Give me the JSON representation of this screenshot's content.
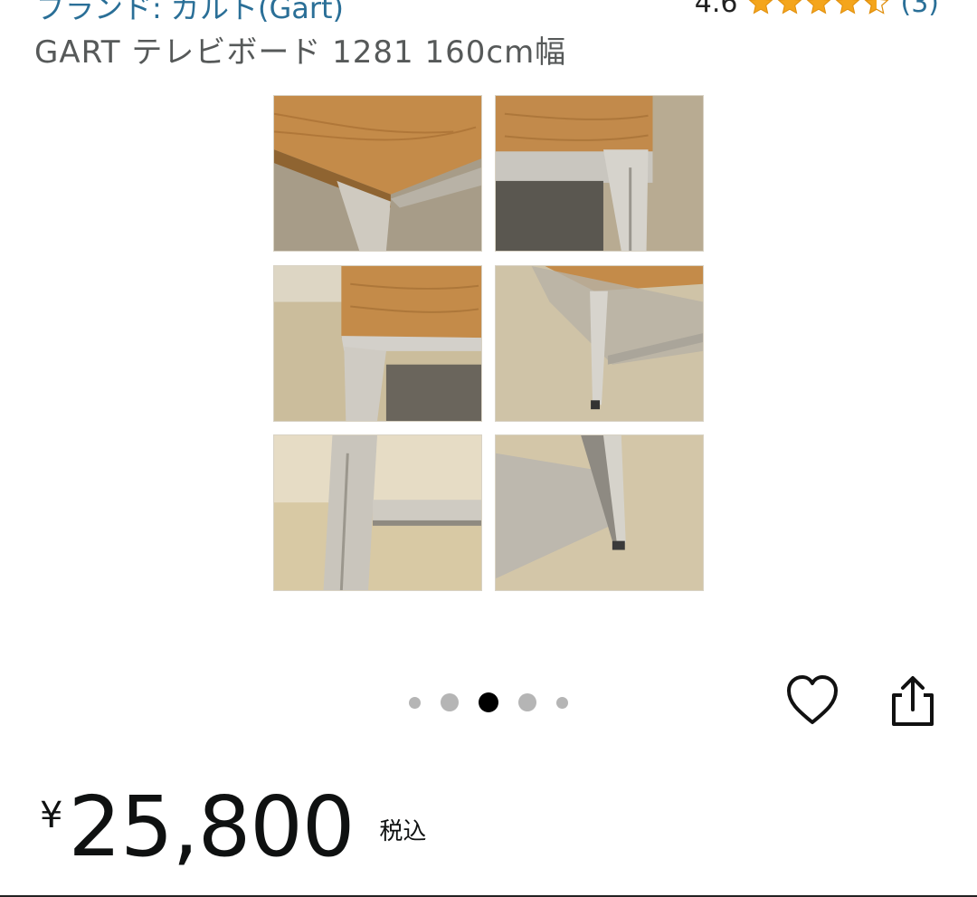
{
  "header": {
    "brand_text": "ブランド: ガルト(Gart)",
    "rating_score": "4.6",
    "rating_stars": 4.5,
    "rating_count": "(3)",
    "star_color": "#f4a51c"
  },
  "product": {
    "title": "GART テレビボード 1281 160cm幅"
  },
  "gallery": {
    "images": [
      "wood-top-corner",
      "steel-leg-closeup",
      "leg-side-view",
      "shelf-leg-angle",
      "leg-crossbar-detail",
      "bottom-shelf-foot"
    ]
  },
  "carousel": {
    "dot_count": 5,
    "active_index": 2
  },
  "actions": {
    "favorite_icon": "heart-icon",
    "share_icon": "share-icon"
  },
  "price": {
    "currency": "¥",
    "amount": "25,800",
    "tax_label": "税込"
  }
}
